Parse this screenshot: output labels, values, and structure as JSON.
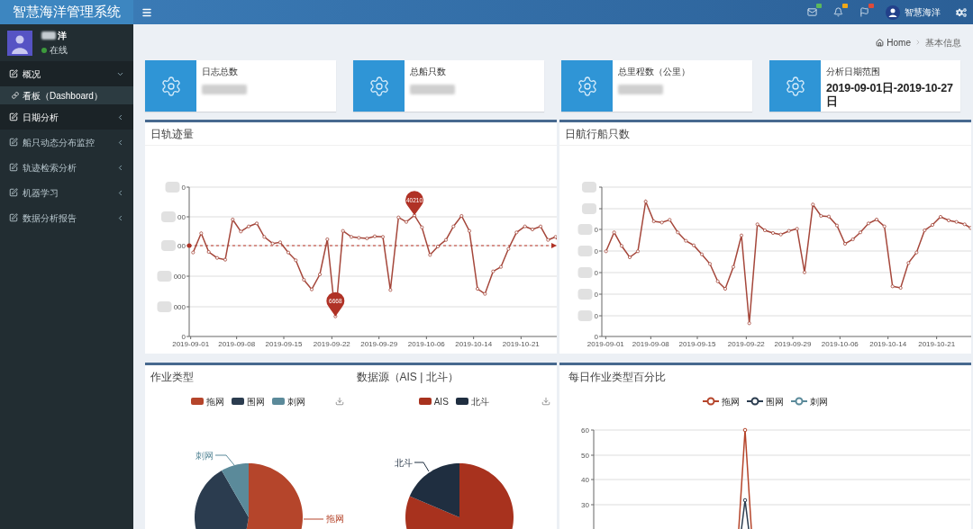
{
  "logo": {
    "title": "智慧海洋管理系统"
  },
  "header": {
    "notifications": [
      {
        "kind": "mail",
        "color": "#5cb85c"
      },
      {
        "kind": "bell",
        "color": "#f0a818"
      },
      {
        "kind": "flag",
        "color": "#dd4b39"
      }
    ],
    "user_name": "智慧海洋"
  },
  "sidebar": {
    "user": {
      "name": "洋",
      "name_partly_hidden": true,
      "status": "在线",
      "online": true
    },
    "menu": [
      {
        "label": "概况",
        "highlighted": true,
        "expanded": true,
        "children": [
          {
            "label": "看板（Dashboard）",
            "selected": true
          }
        ]
      },
      {
        "label": "日期分析",
        "highlighted": true,
        "expanded": false
      },
      {
        "label": "船只动态分布监控",
        "highlighted": false,
        "expanded": false
      },
      {
        "label": "轨迹检索分析",
        "highlighted": false,
        "expanded": false
      },
      {
        "label": "机器学习",
        "highlighted": false,
        "expanded": false
      },
      {
        "label": "数据分析报告",
        "highlighted": false,
        "expanded": false
      }
    ]
  },
  "breadcrumb": [
    {
      "kind": "home",
      "label": "Home"
    },
    {
      "kind": "page",
      "label": "基本信息"
    }
  ],
  "info_boxes": [
    {
      "label": "日志总数",
      "value_hidden": true
    },
    {
      "label": "总船只数",
      "value_hidden": true
    },
    {
      "label": "总里程数（公里）",
      "value_hidden": true
    },
    {
      "label": "分析日期范围",
      "value_hidden": false,
      "value": "2019-09-01日-2019-10-27日"
    }
  ],
  "line_charts": [
    {
      "title": "日轨迹量",
      "y_ticks": [
        {
          "label": "0",
          "hidden": true
        },
        {
          "label": "00",
          "hidden": true
        },
        {
          "label": "00",
          "hidden": true
        },
        {
          "label": "000",
          "hidden": true
        },
        {
          "label": "000",
          "hidden": true
        },
        {
          "label": "0",
          "hidden": false
        }
      ],
      "x_ticks": [
        "2019-09-01",
        "2019-09-08",
        "2019-09-15",
        "2019-09-22",
        "2019-09-29",
        "2019-10-06",
        "2019-10-14",
        "2019-10-21"
      ],
      "markers": [
        {
          "kind": "max",
          "label": "40210"
        },
        {
          "kind": "min",
          "label": "6668"
        }
      ],
      "average_line": true
    },
    {
      "title": "日航行船只数",
      "y_ticks": [
        {
          "hidden": true
        },
        {
          "hidden": true
        },
        {
          "label": "0",
          "hidden": true
        },
        {
          "label": "0",
          "hidden": true
        },
        {
          "label": "0",
          "hidden": true
        },
        {
          "label": "0",
          "hidden": true
        },
        {
          "label": "0",
          "hidden": true
        },
        {
          "label": "0",
          "hidden": false
        }
      ],
      "x_ticks": [
        "2019-09-01",
        "2019-09-08",
        "2019-09-15",
        "2019-09-22",
        "2019-09-29",
        "2019-10-06",
        "2019-10-14",
        "2019-10-21"
      ],
      "average_line": false
    }
  ],
  "pie_charts": [
    {
      "title": "作业类型",
      "legend": [
        {
          "label": "拖网",
          "color": "#b5452b"
        },
        {
          "label": "围网",
          "color": "#2b3c4f"
        },
        {
          "label": "刺网",
          "color": "#5b8a9a"
        }
      ],
      "slices": [
        {
          "color": "#b5452b",
          "label": "拖网"
        },
        {
          "color": "#2b3c4f"
        },
        {
          "color": "#5b8a9a",
          "label": "刺网"
        }
      ]
    },
    {
      "title": "数据源（AIS | 北斗）",
      "legend": [
        {
          "label": "AIS",
          "color": "#a8321e"
        },
        {
          "label": "北斗",
          "color": "#1f2e40"
        }
      ],
      "slices": [
        {
          "color": "#a8321e"
        },
        {
          "color": "#1f2e40",
          "label": "北斗"
        }
      ]
    }
  ],
  "percent_chart": {
    "title": "每日作业类型百分比",
    "legend": [
      {
        "label": "拖网",
        "color": "#b5452b"
      },
      {
        "label": "围网",
        "color": "#2b3c4f"
      },
      {
        "label": "刺网",
        "color": "#5b8a9a"
      }
    ],
    "y_ticks": [
      "60",
      "50",
      "40",
      "30"
    ]
  }
}
